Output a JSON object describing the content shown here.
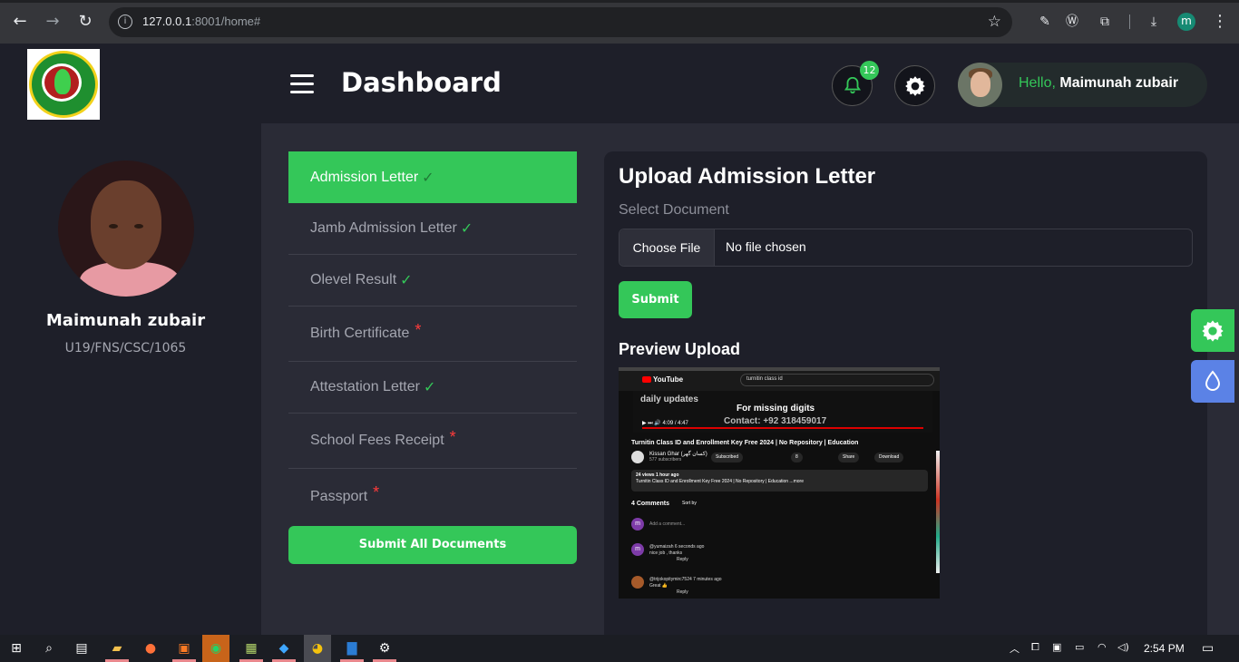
{
  "browser": {
    "url_host": "127.0.0.1",
    "url_rest": ":8001/home#",
    "profile_initial": "m"
  },
  "header": {
    "title": "Dashboard",
    "notification_count": "12",
    "greeting": "Hello,",
    "user_name": "Maimunah zubair"
  },
  "sidebar": {
    "name": "Maimunah zubair",
    "reg_number": "U19/FNS/CSC/1065"
  },
  "documents": [
    {
      "label": "Admission Letter",
      "status": "✓",
      "active": true
    },
    {
      "label": "Jamb Admission Letter",
      "status": "✓"
    },
    {
      "label": "Olevel Result",
      "status": "✓"
    },
    {
      "label": "Birth Certificate",
      "status": "*"
    },
    {
      "label": "Attestation Letter",
      "status": "✓"
    },
    {
      "label": "School Fees Receipt",
      "status": "*"
    },
    {
      "label": "Passport",
      "status": "*"
    }
  ],
  "submit_all_label": "Submit All Documents",
  "upload": {
    "title": "Upload Admission Letter",
    "select_label": "Select Document",
    "choose_file_label": "Choose File",
    "file_status": "No file chosen",
    "submit_label": "Submit",
    "preview_title": "Preview Upload"
  },
  "preview_image": {
    "yt_logo": "YouTube",
    "search_query": "turnitin class id",
    "overlay_line1": "daily updates",
    "overlay_line2": "For missing digits",
    "overlay_line3": "Contact: +92 318459017",
    "time": "4:09 / 4:47",
    "video_title": "Turnitin Class ID and Enrollment Key Free 2024 | No Repository | Education",
    "channel": "Kissan Ghar (کسان گھر)",
    "subscribers": "577 subscribers",
    "subscribed": "Subscribed",
    "likes": "8",
    "share": "Share",
    "download": "Download",
    "views": "24 views  1 hour ago",
    "desc": "Turnitin Class ID and Enrollment Key Free 2024 | No Repository | Education ...more",
    "comments_count": "4 Comments",
    "sort_by": "Sort by",
    "add_comment": "Add a comment...",
    "comment1_user": "@yumaizah  6 seconds ago",
    "comment1_text": "nice job , thanks",
    "comment2_user": "@trijokopitymirc7524  7 minutes ago",
    "comment2_text": "Great 👍",
    "reply": "Reply"
  },
  "taskbar": {
    "time": "2:54 PM"
  },
  "colors": {
    "accent": "#34c759",
    "page_bg": "#1e1f29",
    "main_bg": "#2a2b36",
    "required": "#ff3b3b",
    "drop_button": "#5b82e6"
  }
}
